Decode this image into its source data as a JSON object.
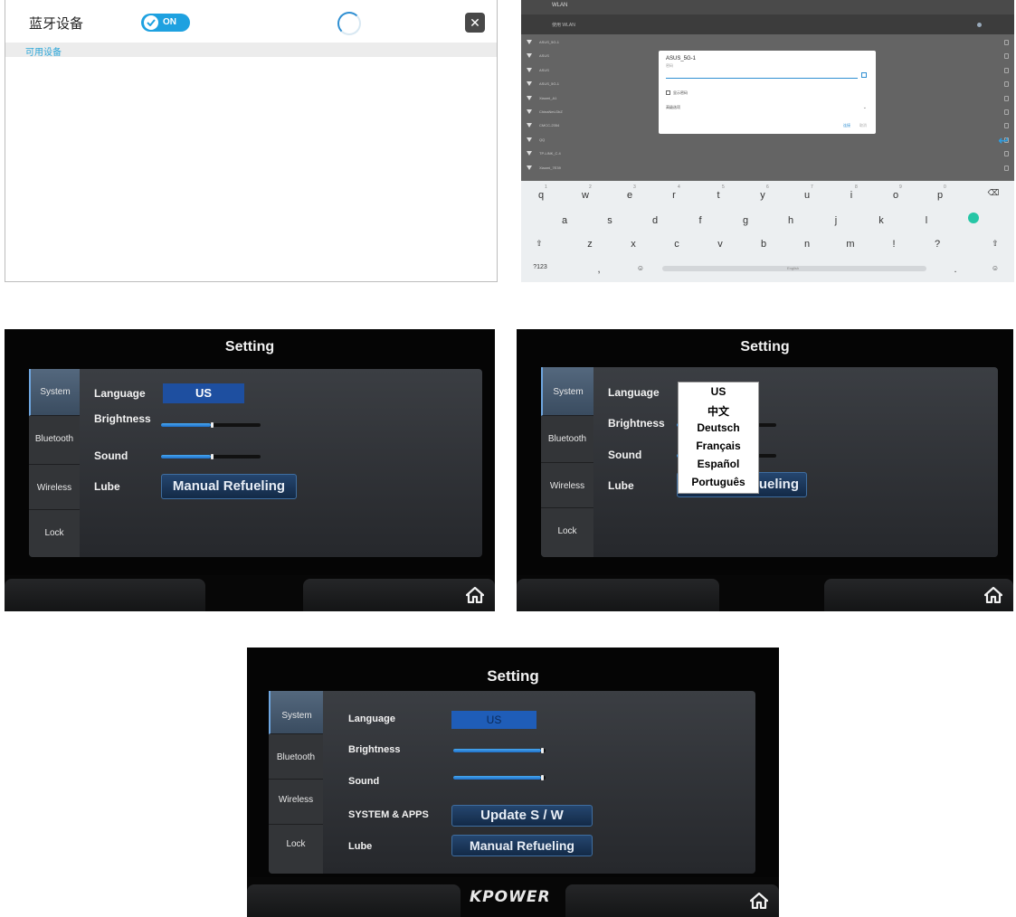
{
  "bluetooth_panel": {
    "title": "蓝牙设备",
    "toggle_label": "ON",
    "available_section": "可用设备",
    "close_symbol": "✕"
  },
  "wlan_panel": {
    "header": "WLAN",
    "subheader": "使用 WLAN",
    "networks": [
      "ASUS_5G-1",
      "ASUS",
      "ASUS",
      "ASUS_5G-1",
      "Xiaomi_A1",
      "ChinaNet-GbZ",
      "CMCC-2354",
      "QQ",
      "TP-LINK_C.4",
      "Xiaomi_7E39"
    ],
    "dialog": {
      "ssid": "ASUS_5G-1",
      "password_label": "密码",
      "show_password": "显示密码",
      "advanced": "高级选项",
      "connect": "连接",
      "cancel": "取消"
    },
    "keyboard": {
      "row1": [
        "q",
        "w",
        "e",
        "r",
        "t",
        "y",
        "u",
        "i",
        "o",
        "p"
      ],
      "row1_hints": [
        "1",
        "2",
        "3",
        "4",
        "5",
        "6",
        "7",
        "8",
        "9",
        "0"
      ],
      "row2": [
        "a",
        "s",
        "d",
        "f",
        "g",
        "h",
        "j",
        "k",
        "l"
      ],
      "row3": [
        "z",
        "x",
        "c",
        "v",
        "b",
        "n",
        "m",
        "!",
        "?"
      ],
      "mode_key": "?123",
      "comma": ",",
      "period": ".",
      "space_label": "English"
    }
  },
  "setting_screen_1": {
    "title": "Setting",
    "tabs": [
      "System",
      "Bluetooth",
      "Wireless",
      "Lock"
    ],
    "language_label": "Language",
    "language_value": "US",
    "brightness_label": "Brightness",
    "brightness_level": 0.5,
    "sound_label": "Sound",
    "sound_level": 0.5,
    "lube_label": "Lube",
    "lube_button": "Manual Refueling"
  },
  "setting_screen_2": {
    "title": "Setting",
    "tabs": [
      "System",
      "Bluetooth",
      "Wireless",
      "Lock"
    ],
    "language_label": "Language",
    "brightness_label": "Brightness",
    "sound_label": "Sound",
    "lube_label": "Lube",
    "lube_button_partial": "ueling",
    "language_options": [
      "US",
      "中文",
      "Deutsch",
      "Français",
      "Español",
      "Português"
    ]
  },
  "setting_screen_3": {
    "title": "Setting",
    "tabs": [
      "System",
      "Bluetooth",
      "Wireless",
      "Lock"
    ],
    "language_label": "Language",
    "language_value": "US",
    "brightness_label": "Brightness",
    "brightness_level": 0.95,
    "sound_label": "Sound",
    "sound_level": 0.95,
    "system_apps_label": "SYSTEM & APPS",
    "update_button": "Update S / W",
    "lube_label": "Lube",
    "lube_button": "Manual Refueling",
    "brand": "KPOWER"
  },
  "colors": {
    "bluetooth_accent": "#1ea1e0",
    "language_button": "#1e4fa0",
    "slider_fill": "#2f8fe0"
  }
}
